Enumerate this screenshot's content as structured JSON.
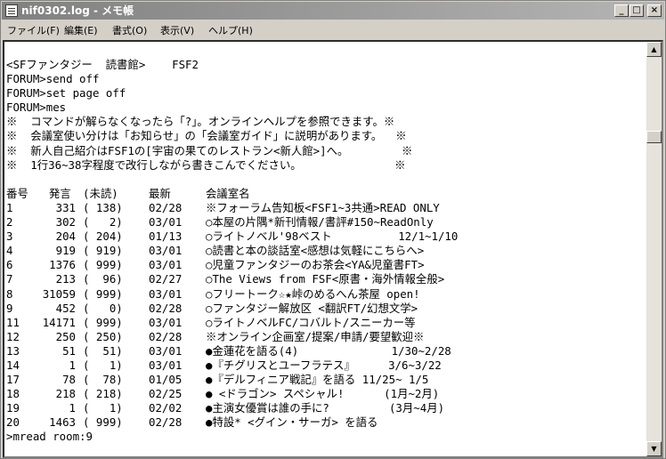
{
  "window": {
    "title": "nif0302.log - メモ帳"
  },
  "menu": [
    "ファイル(F)",
    "編集(E)",
    "書式(O)",
    "表示(V)",
    "ヘルプ(H)"
  ],
  "intro_lines": [
    "<SFファンタジー  読書館>    FSF2",
    "FORUM>send off",
    "FORUM>set page off",
    "FORUM>mes",
    "※  コマンドが解らなくなったら「?」。オンラインヘルプを参照できます。※",
    "※  会議室使い分けは「お知らせ」の「会議室ガイド」に説明があります。  ※",
    "※  新人自己紹介はFSF1の[宇宙の果てのレストラン<新人館>]へ。        ※",
    "※  1行36~38字程度で改行しながら書きこんでください。              ※",
    ""
  ],
  "table": {
    "headers": {
      "num": "番号",
      "posts": "発言",
      "unread": "(未読)",
      "latest": "最新",
      "name": "会議室名"
    },
    "rows": [
      {
        "num": "1",
        "posts": "331",
        "unread": "( 138)",
        "date": "02/28",
        "name": "※フォーラム告知板<FSF1~3共通>READ ONLY"
      },
      {
        "num": "2",
        "posts": "302",
        "unread": "(   2)",
        "date": "03/01",
        "name": "○本屋の片隅*新刊情報/書評#150~ReadOnly"
      },
      {
        "num": "3",
        "posts": "204",
        "unread": "( 204)",
        "date": "01/13",
        "name": "○ライトノベル'98ベスト          12/1~1/10"
      },
      {
        "num": "4",
        "posts": "919",
        "unread": "( 919)",
        "date": "03/01",
        "name": "○読書と本の談話室<感想は気軽にこちらへ>"
      },
      {
        "num": "6",
        "posts": "1376",
        "unread": "( 999)",
        "date": "03/01",
        "name": "○児童ファンタジーのお茶会<YA&児童書FT>"
      },
      {
        "num": "7",
        "posts": "213",
        "unread": "(  96)",
        "date": "02/27",
        "name": "○The Views from FSF<原書・海外情報全般>"
      },
      {
        "num": "8",
        "posts": "31059",
        "unread": "( 999)",
        "date": "03/01",
        "name": "○フリートーク☆★峠のめるへん茶屋 open!"
      },
      {
        "num": "9",
        "posts": "452",
        "unread": "(   0)",
        "date": "02/28",
        "name": "○ファンタジー解放区 <翻訳FT/幻想文学>"
      },
      {
        "num": "11",
        "posts": "14171",
        "unread": "( 999)",
        "date": "03/01",
        "name": "○ライトノベルFC/コバルト/スニーカー等"
      },
      {
        "num": "12",
        "posts": "250",
        "unread": "( 250)",
        "date": "02/28",
        "name": "※オンライン企画室/提案/申請/要望歓迎※"
      },
      {
        "num": "13",
        "posts": "51",
        "unread": "(  51)",
        "date": "03/01",
        "name": "●金蓮花を語る(4)              1/30~2/28"
      },
      {
        "num": "14",
        "posts": "1",
        "unread": "(   1)",
        "date": "03/01",
        "name": "●『チグリスとユーフラテス』     3/6~3/22"
      },
      {
        "num": "17",
        "posts": "78",
        "unread": "(  78)",
        "date": "01/05",
        "name": "●『デルフィニア戦記』を語る 11/25~ 1/5"
      },
      {
        "num": "18",
        "posts": "218",
        "unread": "( 218)",
        "date": "02/25",
        "name": "● <ドラゴン> スペシャル!      (1月~2月)"
      },
      {
        "num": "19",
        "posts": "1",
        "unread": "(   1)",
        "date": "02/02",
        "name": "●主演女優賞は誰の手に?         (3月~4月)"
      },
      {
        "num": "20",
        "posts": "1463",
        "unread": "( 999)",
        "date": "02/28",
        "name": "●特設* <グイン・サーガ> を語る"
      }
    ]
  },
  "prompt": ">mread room:9",
  "icons": {
    "app": "notepad-icon",
    "minimize": "minimize-icon",
    "maximize": "maximize-icon",
    "close": "close-icon",
    "scroll_up": "arrow-up-icon",
    "scroll_down": "arrow-down-icon"
  },
  "colors": {
    "titlebar": "#8c8c8c",
    "chrome": "#d4d0c8",
    "text": "#000000",
    "background": "#ffffff"
  }
}
